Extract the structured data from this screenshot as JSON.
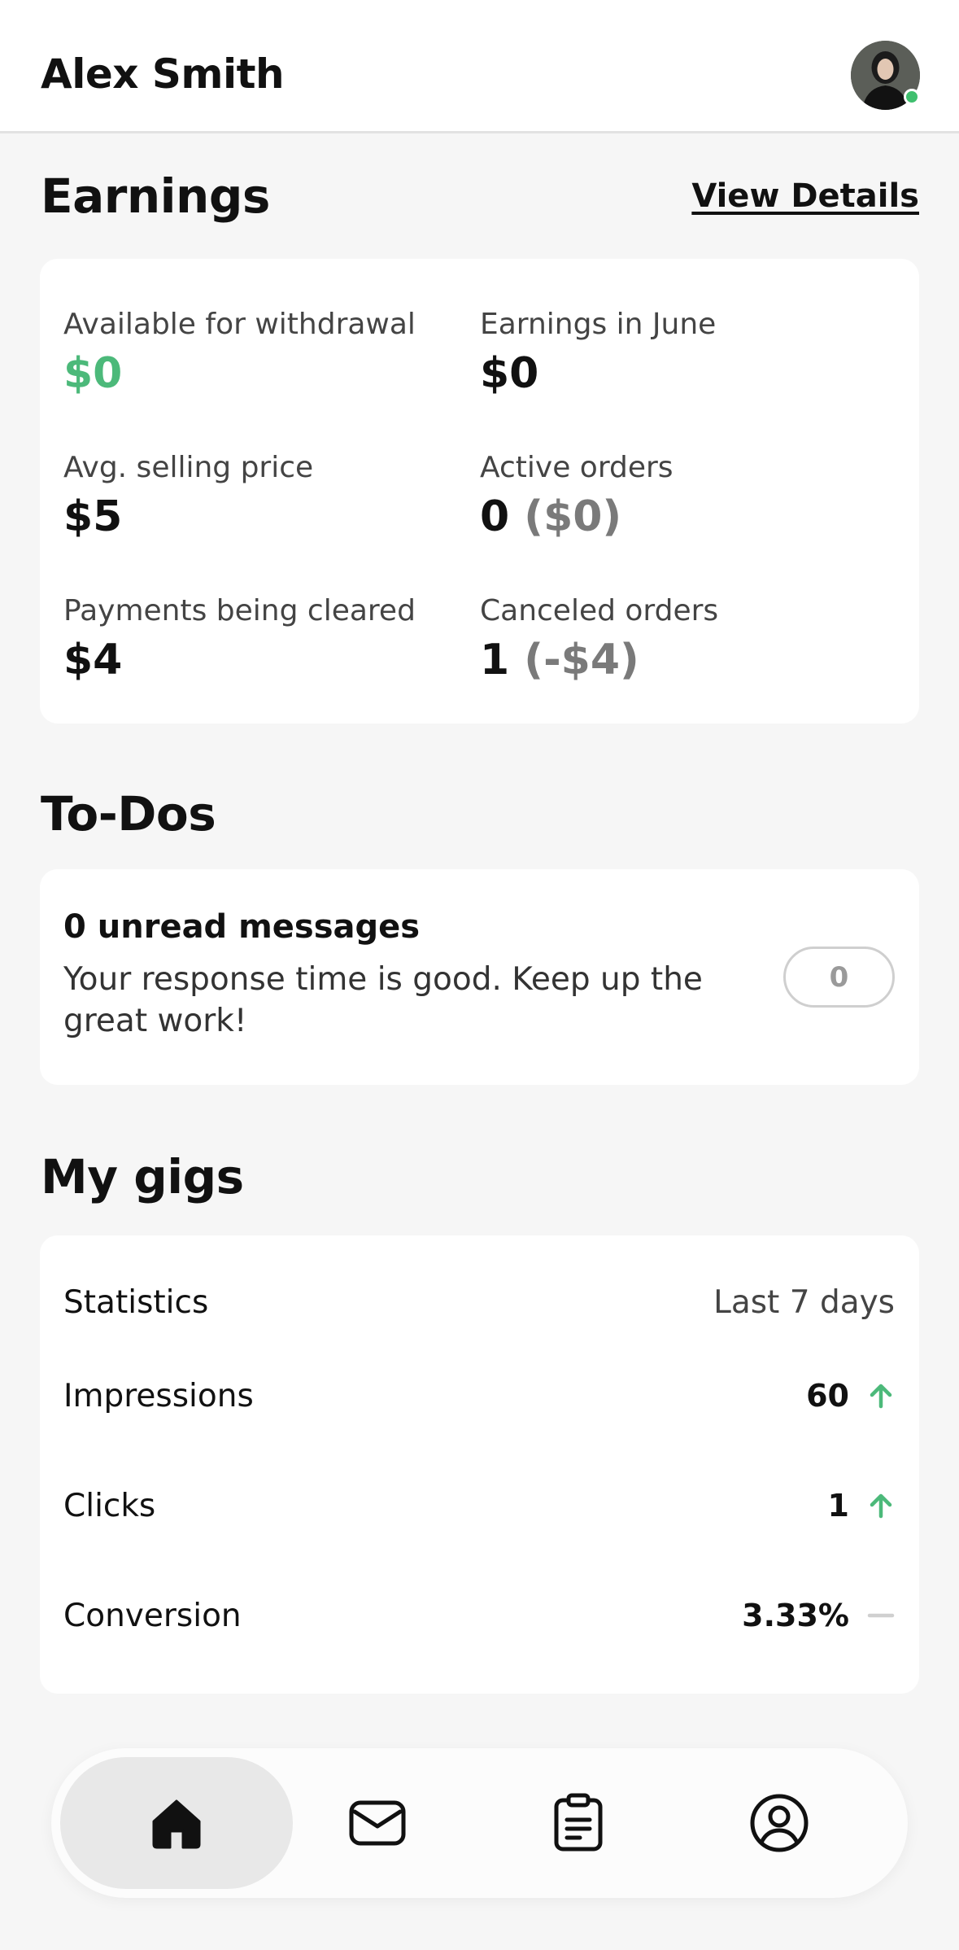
{
  "header": {
    "user_name": "Alex Smith"
  },
  "earnings": {
    "title": "Earnings",
    "view_details": "View Details",
    "available": {
      "label": "Available for withdrawal",
      "value": "$0"
    },
    "month": {
      "label": "Earnings in June",
      "value": "$0"
    },
    "avg_price": {
      "label": "Avg. selling price",
      "value": "$5"
    },
    "active_orders": {
      "label": "Active orders",
      "count": "0",
      "amount": "($0)"
    },
    "payments_clearing": {
      "label": "Payments being cleared",
      "value": "$4"
    },
    "canceled_orders": {
      "label": "Canceled orders",
      "count": "1",
      "amount": "(-$4)"
    }
  },
  "todos": {
    "title": "To-Dos",
    "messages_title": "0 unread messages",
    "messages_desc": "Your response time is good. Keep up the great work!",
    "badge_count": "0"
  },
  "gigs": {
    "title": "My gigs",
    "statistics_label": "Statistics",
    "period": "Last 7 days",
    "rows": [
      {
        "label": "Impressions",
        "value": "60",
        "trend": "up"
      },
      {
        "label": "Clicks",
        "value": "1",
        "trend": "up"
      },
      {
        "label": "Conversion",
        "value": "3.33%",
        "trend": "flat"
      }
    ]
  },
  "nav": {
    "items": [
      {
        "icon": "home-icon",
        "active": true
      },
      {
        "icon": "inbox-icon",
        "active": false
      },
      {
        "icon": "orders-icon",
        "active": false
      },
      {
        "icon": "profile-icon",
        "active": false
      }
    ]
  },
  "colors": {
    "accent_green": "#4cb97a",
    "online": "#3fbf6e",
    "muted": "#7a7a7a"
  }
}
